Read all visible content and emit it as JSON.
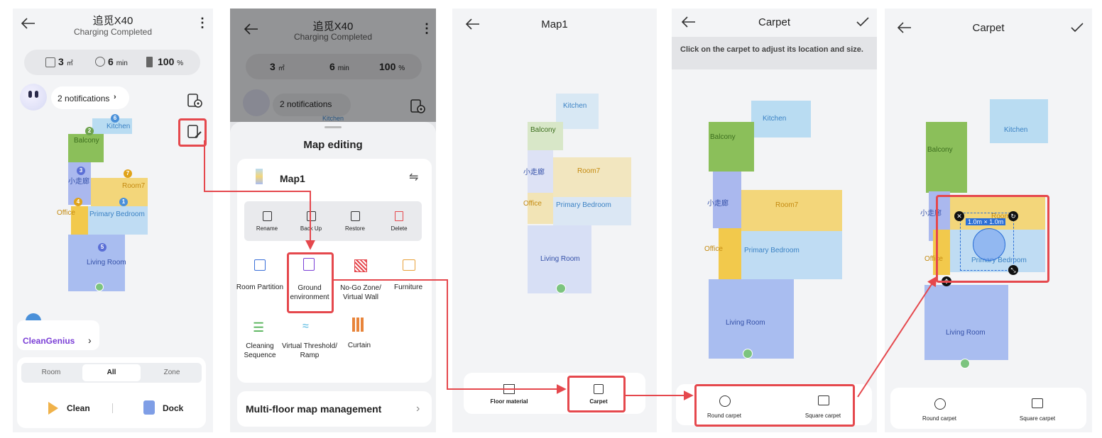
{
  "screen1": {
    "title": "追觅X40",
    "subtitle": "Charging Completed",
    "stats": {
      "area_value": "3",
      "area_unit": "㎡",
      "time_value": "6",
      "time_unit": "min",
      "battery_value": "100",
      "battery_unit": "%"
    },
    "notifications": "2 notifications",
    "rooms": {
      "balcony": "Balcony",
      "kitchen": "Kitchen",
      "corridor": "小走廊",
      "room7": "Room7",
      "office": "Office",
      "primary_bedroom": "Primary Bedroom",
      "living_room": "Living Room"
    },
    "pins": {
      "p2": "2",
      "p6": "6",
      "p3": "3",
      "p7": "7",
      "p4": "4",
      "p1": "1",
      "p5": "5"
    },
    "clean_genius": "CleanGenius",
    "mode_tabs": [
      "Room",
      "All",
      "Zone"
    ],
    "clean_label": "Clean",
    "dock_label": "Dock"
  },
  "screen2": {
    "title": "追觅X40",
    "subtitle": "Charging Completed",
    "stats": {
      "area_value": "3",
      "area_unit": "㎡",
      "time_value": "6",
      "time_unit": "min",
      "battery_value": "100",
      "battery_unit": "%"
    },
    "notifications": "2 notifications",
    "kitchen_peek": "Kitchen",
    "sheet_title": "Map editing",
    "map_name": "Map1",
    "actions": [
      "Rename",
      "Back Up",
      "Restore",
      "Delete"
    ],
    "tools": [
      {
        "label": "Room Partition"
      },
      {
        "label": "Ground environment"
      },
      {
        "label": "No-Go Zone/ Virtual Wall"
      },
      {
        "label": "Furniture"
      },
      {
        "label": "Cleaning Sequence"
      },
      {
        "label": "Virtual Threshold/ Ramp"
      },
      {
        "label": "Curtain"
      }
    ],
    "multi_floor": "Multi-floor map management"
  },
  "screen3": {
    "title": "Map1",
    "rooms": {
      "kitchen": "Kitchen",
      "balcony": "Balcony",
      "corridor": "小走廊",
      "room7": "Room7",
      "office": "Office",
      "primary_bedroom": "Primary Bedroom",
      "living_room": "Living Room"
    },
    "options": {
      "floor_material": "Floor material",
      "carpet": "Carpet"
    }
  },
  "screen4": {
    "title": "Carpet",
    "instruction": "Click on the carpet to adjust its location and size.",
    "rooms": {
      "kitchen": "Kitchen",
      "balcony": "Balcony",
      "corridor": "小走廊",
      "room7": "Room7",
      "office": "Office",
      "primary_bedroom": "Primary Bedroom",
      "living_room": "Living Room"
    },
    "options": {
      "round": "Round carpet",
      "square": "Square carpet"
    }
  },
  "screen5": {
    "title": "Carpet",
    "rooms": {
      "kitchen": "Kitchen",
      "balcony": "Balcony",
      "corridor": "小走廊",
      "room7": "Room7",
      "office": "Office",
      "primary_bedroom": "Primary Bedroom",
      "living_room": "Living Room"
    },
    "carpet_size": "1.0m × 1.0m",
    "options": {
      "round": "Round carpet",
      "square": "Square carpet"
    }
  },
  "colors": {
    "highlight": "#e5484d",
    "balcony": "#8bbf5a",
    "kitchen": "#b9dcf2",
    "room7": "#f3d67a",
    "office": "#f2c94c",
    "bedroom": "#bfdcf3",
    "living": "#a9bdf0",
    "corridor": "#aab8ee",
    "clean_genius": "#7a3ed6"
  }
}
